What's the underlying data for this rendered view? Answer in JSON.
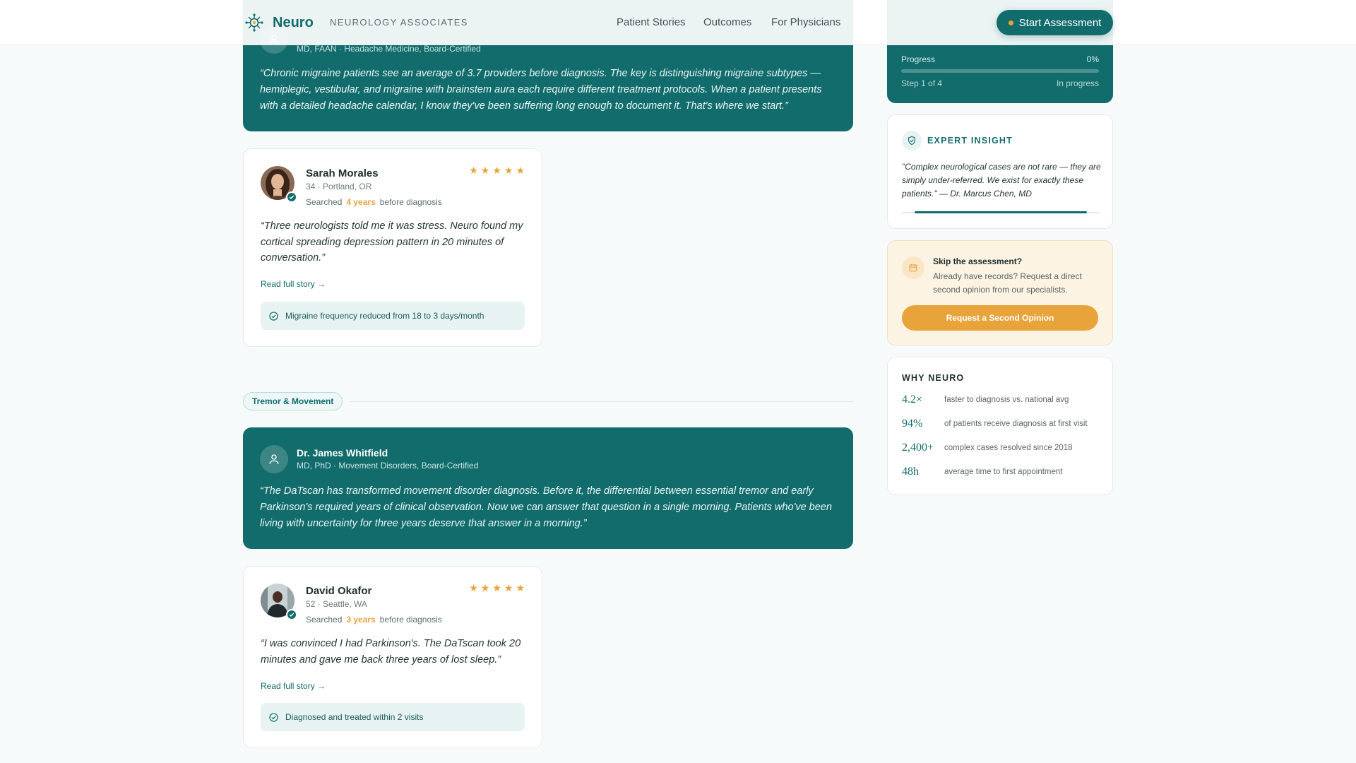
{
  "header": {
    "brand": "Neuro",
    "tagline": "NEUROLOGY ASSOCIATES",
    "nav": [
      "Patient Stories",
      "Outcomes",
      "For Physicians"
    ],
    "cta": "Start Assessment"
  },
  "quotes": [
    {
      "name": "",
      "credentials": "MD, FAAN · Headache Medicine, Board-Certified",
      "quote": "“Chronic migraine patients see an average of 3.7 providers before diagnosis. The key is distinguishing migraine subtypes — hemiplegic, vestibular, and migraine with brainstem aura each require different treatment protocols. When a patient presents with a detailed headache calendar, I know they've been suffering long enough to document it. That's where we start.”"
    },
    {
      "name": "Dr. James Whitfield",
      "credentials": "MD, PhD · Movement Disorders, Board-Certified",
      "quote": "“The DaTscan has transformed movement disorder diagnosis. Before it, the differential between essential tremor and early Parkinson's required years of clinical observation. Now we can answer that question in a single morning. Patients who've been living with uncertainty for three years deserve that answer in a morning.”"
    }
  ],
  "section": {
    "tag": "Tremor & Movement"
  },
  "patients": [
    {
      "name": "Sarah Morales",
      "meta": "34 · Portland, OR",
      "searched_prefix": "Searched",
      "searched_duration": "4 years",
      "searched_suffix": "before diagnosis",
      "rating": 5,
      "quote": "“Three neurologists told me it was stress. Neuro found my cortical spreading depression pattern in 20 minutes of conversation.”",
      "link": "Read full story →",
      "outcome": "Migraine frequency reduced from 18 to 3 days/month"
    },
    {
      "name": "David Okafor",
      "meta": "52 · Seattle, WA",
      "searched_prefix": "Searched",
      "searched_duration": "3 years",
      "searched_suffix": "before diagnosis",
      "rating": 5,
      "quote": "“I was convinced I had Parkinson's. The DaTscan took 20 minutes and gave me back three years of lost sleep.”",
      "link": "Read full story →",
      "outcome": "Diagnosed and treated within 2 visits"
    }
  ],
  "progress": {
    "label": "Progress",
    "percent_text": "0%",
    "fraction": 0,
    "step": "Step 1 of 4",
    "status": "In progress"
  },
  "insight": {
    "title": "EXPERT INSIGHT",
    "quote": "\"Complex neurological cases are not rare — they are simply under-referred. We exist for exactly these patients.\" — Dr. Marcus Chen, MD",
    "carousel_fraction": 0.87
  },
  "skip": {
    "title": "Skip the assessment?",
    "description": "Already have records? Request a direct second opinion from our specialists.",
    "button": "Request a Second Opinion"
  },
  "why": {
    "title": "WHY NEURO",
    "stats": [
      {
        "value": "4.2×",
        "text": "faster to diagnosis vs. national avg"
      },
      {
        "value": "94%",
        "text": "of patients receive diagnosis at first visit"
      },
      {
        "value": "2,400+",
        "text": "complex cases resolved since 2018"
      },
      {
        "value": "48h",
        "text": "average time to first appointment"
      }
    ]
  },
  "colors": {
    "brand_teal": "#126c6c",
    "accent_amber": "#e8a33a",
    "page_bg": "#f7fafa"
  },
  "icons": {
    "logo": "neuron-logo-icon",
    "verified": "check-badge-icon",
    "outcome": "check-circle-icon",
    "insight": "shield-check-icon",
    "skip": "calendar-icon",
    "doctor": "user-icon",
    "star": "star-icon"
  }
}
